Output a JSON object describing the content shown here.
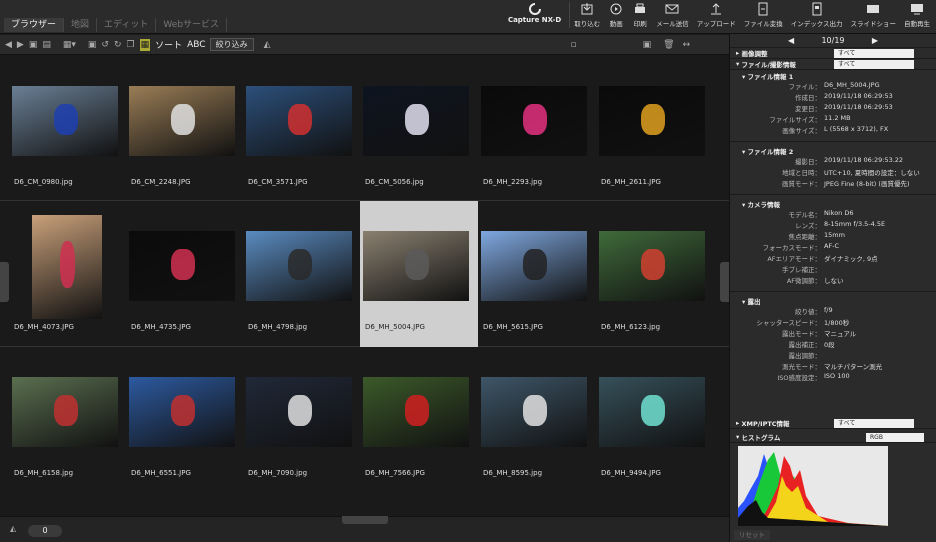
{
  "mode_tabs": [
    "ブラウザー",
    "地図",
    "エディット",
    "Webサービス"
  ],
  "tools": {
    "capture_nxd": "Capture NX-D",
    "import": "取り込む",
    "movie": "動画",
    "print": "印刷",
    "mail": "メール送信",
    "upload": "アップロード",
    "convert": "ファイル変換",
    "index": "インデックス出力",
    "slideshow": "スライドショー",
    "autoplay": "自動再生"
  },
  "toolbar": {
    "sort_label": "ソート",
    "sort_mode": "ABC",
    "filter_label": "絞り込み"
  },
  "thumbnails": [
    [
      "D6_CM_0980.jpg",
      "D6_CM_2248.JPG",
      "D6_CM_3571.JPG",
      "D6_CM_5056.jpg",
      "D6_MH_2293.jpg",
      "D6_MH_2611.JPG"
    ],
    [
      "D6_MH_4073.JPG",
      "D6_MH_4735.JPG",
      "D6_MH_4798.jpg",
      "D6_MH_5004.JPG",
      "D6_MH_5615.JPG",
      "D6_MH_6123.jpg"
    ],
    [
      "D6_MH_6158.jpg",
      "D6_MH_6551.JPG",
      "D6_MH_7090.jpg",
      "D6_MH_7566.JPG",
      "D6_MH_8595.jpg",
      "D6_MH_9494.JPG"
    ]
  ],
  "selected_count": "0",
  "panel": {
    "counter": "10/19",
    "image_adjust": "画像調整",
    "file_info": "ファイル/撮影情報",
    "all": "すべて",
    "file_info1": "ファイル情報 1",
    "fi1": [
      [
        "ファイル：",
        "D6_MH_5004.JPG"
      ],
      [
        "作成日：",
        "2019/11/18 06:29:53"
      ],
      [
        "変更日：",
        "2019/11/18 06:29:53"
      ],
      [
        "ファイルサイズ：",
        "11.2 MB"
      ],
      [
        "画像サイズ：",
        "L (5568 x 3712), FX"
      ]
    ],
    "file_info2": "ファイル情報 2",
    "fi2": [
      [
        "撮影日：",
        "2019/11/18 06:29:53.22"
      ],
      [
        "地域と日時：",
        "UTC+10, 夏時間の設定：しない"
      ],
      [
        "画質モード：",
        "JPEG Fine (8-bit) (画質優先)"
      ]
    ],
    "camera_info": "カメラ情報",
    "ci": [
      [
        "モデル名：",
        "Nikon D6"
      ],
      [
        "レンズ：",
        "8-15mm f/3.5-4.5E"
      ],
      [
        "焦点距離：",
        "15mm"
      ],
      [
        "フォーカスモード：",
        "AF-C"
      ],
      [
        "AFエリアモード：",
        "ダイナミック, 9点"
      ],
      [
        "手ブレ補正：",
        ""
      ],
      [
        "AF微調節：",
        "しない"
      ]
    ],
    "exposure": "露出",
    "ex": [
      [
        "絞り値：",
        "f/9"
      ],
      [
        "シャッタースピード：",
        "1/800秒"
      ],
      [
        "露出モード：",
        "マニュアル"
      ],
      [
        "露出補正：",
        "0段"
      ],
      [
        "露出調節：",
        ""
      ],
      [
        "測光モード：",
        "マルチパターン測光"
      ],
      [
        "ISO感度設定：",
        "ISO 100"
      ]
    ],
    "xmp": "XMP/IPTC情報",
    "histogram": "ヒストグラム",
    "rgb": "RGB",
    "reset": "リセット"
  }
}
